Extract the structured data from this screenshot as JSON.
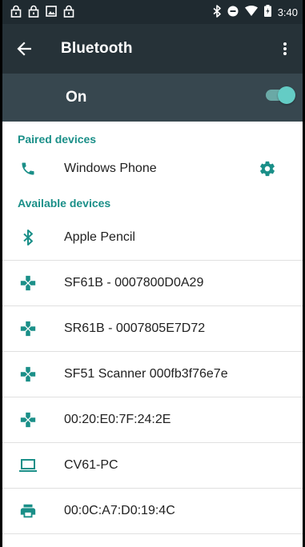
{
  "status_bar": {
    "time": "3:40",
    "left_icons": [
      "lock-icon",
      "lock-icon",
      "image-icon",
      "lock-icon"
    ],
    "right_icons": [
      "bluetooth-icon",
      "dnd-icon",
      "wifi-icon",
      "battery-icon"
    ]
  },
  "appbar": {
    "title": "Bluetooth"
  },
  "toggle": {
    "label": "On",
    "on": true
  },
  "paired": {
    "header": "Paired devices",
    "devices": [
      {
        "name": "Windows Phone",
        "icon": "phone-icon"
      }
    ]
  },
  "available": {
    "header": "Available devices",
    "devices": [
      {
        "name": "Apple Pencil",
        "icon": "bluetooth-icon"
      },
      {
        "name": "SF61B - 0007800D0A29",
        "icon": "gamepad-icon"
      },
      {
        "name": "SR61B - 0007805E7D72",
        "icon": "gamepad-icon"
      },
      {
        "name": "SF51 Scanner 000fb3f76e7e",
        "icon": "gamepad-icon"
      },
      {
        "name": "00:20:E0:7F:24:2E",
        "icon": "gamepad-icon"
      },
      {
        "name": "CV61-PC",
        "icon": "laptop-icon"
      },
      {
        "name": "00:0C:A7:D0:19:4C",
        "icon": "printer-icon"
      }
    ]
  },
  "colors": {
    "appbar": "#263238",
    "toggle_row": "#37474f",
    "accent": "#1a8f88",
    "switch_knob": "#64ccc5"
  }
}
